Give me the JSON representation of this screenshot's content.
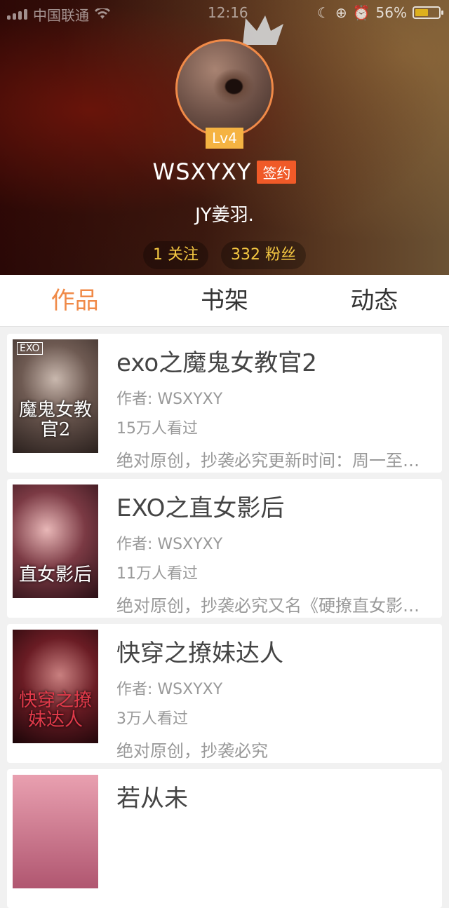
{
  "status_bar": {
    "carrier": "中国联通",
    "time": "12:16",
    "battery_percent": "56%",
    "battery_level": 0.56
  },
  "profile": {
    "level": "Lv4",
    "username": "WSXYXY",
    "badge": "签约",
    "bio": "JY姜羽.",
    "following": "1 关注",
    "followers": "332 粉丝"
  },
  "colors": {
    "accent": "#f08a48",
    "badge_red": "#f05a28",
    "level_yellow": "#f5b342",
    "stat_yellow": "#f5c842"
  },
  "tabs": [
    {
      "label": "作品",
      "active": true
    },
    {
      "label": "书架",
      "active": false
    },
    {
      "label": "动态",
      "active": false
    }
  ],
  "books": [
    {
      "title": "exo之魔鬼女教官2",
      "author": "作者: WSXYXY",
      "views": "15万人看过",
      "desc": "绝对原创，抄袭必究更新时间：周一至周五",
      "cover_text": "魔鬼女教官2"
    },
    {
      "title": "EXO之直女影后",
      "author": "作者: WSXYXY",
      "views": "11万人看过",
      "desc": "绝对原创，抄袭必究又名《硬撩直女影后》",
      "cover_text": "直女影后"
    },
    {
      "title": "快穿之撩妹达人",
      "author": "作者: WSXYXY",
      "views": "3万人看过",
      "desc": "绝对原创，抄袭必究",
      "cover_text": "快穿之撩妹达人"
    },
    {
      "title": "若从未",
      "author": "",
      "views": "",
      "desc": "",
      "cover_text": ""
    }
  ]
}
